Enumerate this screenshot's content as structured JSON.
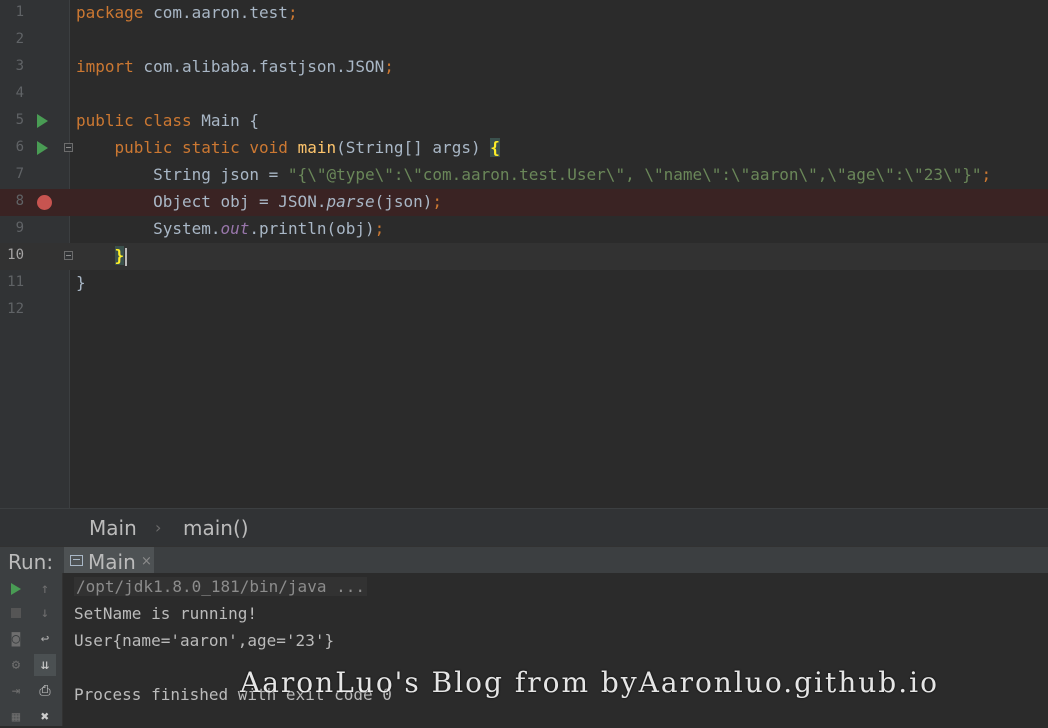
{
  "editor": {
    "lines": [
      {
        "num": "1",
        "segs": [
          {
            "t": "package",
            "c": "kw"
          },
          {
            "t": " com.aaron.test"
          },
          {
            "t": ";",
            "c": "kw"
          }
        ]
      },
      {
        "num": "2",
        "segs": []
      },
      {
        "num": "3",
        "segs": [
          {
            "t": "import",
            "c": "kw"
          },
          {
            "t": " com.alibaba.fastjson.JSON"
          },
          {
            "t": ";",
            "c": "kw"
          }
        ]
      },
      {
        "num": "4",
        "segs": []
      },
      {
        "num": "5",
        "segs": [
          {
            "t": "public class",
            "c": "kw"
          },
          {
            "t": " Main {"
          }
        ],
        "run": true
      },
      {
        "num": "6",
        "segs": [
          {
            "t": "    "
          },
          {
            "t": "public static void",
            "c": "kw"
          },
          {
            "t": " "
          },
          {
            "t": "main",
            "c": "fn"
          },
          {
            "t": "(String[] args) "
          },
          {
            "t": "{",
            "c": "brace"
          }
        ],
        "run": true,
        "fold": true
      },
      {
        "num": "7",
        "segs": [
          {
            "t": "        String json = "
          },
          {
            "t": "\"{\\\"@type\\\":\\\"com.aaron.test.User\\\", \\\"name\\\":\\\"aaron\\\",\\\"age\\\":\\\"23\\\"}\"",
            "c": "str"
          },
          {
            "t": ";",
            "c": "kw"
          }
        ]
      },
      {
        "num": "8",
        "segs": [
          {
            "t": "        Object obj = JSON."
          },
          {
            "t": "parse",
            "c": "ital"
          },
          {
            "t": "(json)"
          },
          {
            "t": ";",
            "c": "kw"
          }
        ],
        "breakpoint": true
      },
      {
        "num": "9",
        "segs": [
          {
            "t": "        System."
          },
          {
            "t": "out",
            "c": "field"
          },
          {
            "t": ".println(obj)"
          },
          {
            "t": ";",
            "c": "kw"
          }
        ]
      },
      {
        "num": "10",
        "segs": [
          {
            "t": "    "
          },
          {
            "t": "}",
            "c": "brace"
          }
        ],
        "current": true,
        "fold": true
      },
      {
        "num": "11",
        "segs": [
          {
            "t": "}"
          }
        ]
      },
      {
        "num": "12",
        "segs": []
      }
    ]
  },
  "breadcrumb": {
    "class_name": "Main",
    "method_name": "main()"
  },
  "run_panel": {
    "label": "Run:",
    "tab_label": "Main",
    "tab_close": "×",
    "console": [
      {
        "text": "/opt/jdk1.8.0_181/bin/java ...",
        "kind": "cmd"
      },
      {
        "text": "SetName is running!",
        "kind": "out"
      },
      {
        "text": "User{name='aaron',age='23'}",
        "kind": "out"
      },
      {
        "text": "",
        "kind": "out"
      },
      {
        "text": "Process finished with exit code 0",
        "kind": "out"
      }
    ]
  },
  "toolbar_icons": [
    {
      "name": "rerun-icon",
      "symbol": "play"
    },
    {
      "name": "scroll-up-icon",
      "symbol": "↑"
    },
    {
      "name": "stop-icon",
      "symbol": "stop"
    },
    {
      "name": "scroll-down-icon",
      "symbol": "↓"
    },
    {
      "name": "dump-threads-icon",
      "symbol": "📷"
    },
    {
      "name": "soft-wrap-icon",
      "symbol": "↩"
    },
    {
      "name": "settings-icon",
      "symbol": "⚙"
    },
    {
      "name": "scroll-to-end-icon",
      "symbol": "⇊"
    },
    {
      "name": "exit-icon",
      "symbol": "⇥"
    },
    {
      "name": "print-icon",
      "symbol": "⎙"
    },
    {
      "name": "layout-icon",
      "symbol": "▦"
    },
    {
      "name": "trash-icon",
      "symbol": "🗑"
    }
  ],
  "watermark": "AaronLuo's Blog from byAaronluo.github.io"
}
